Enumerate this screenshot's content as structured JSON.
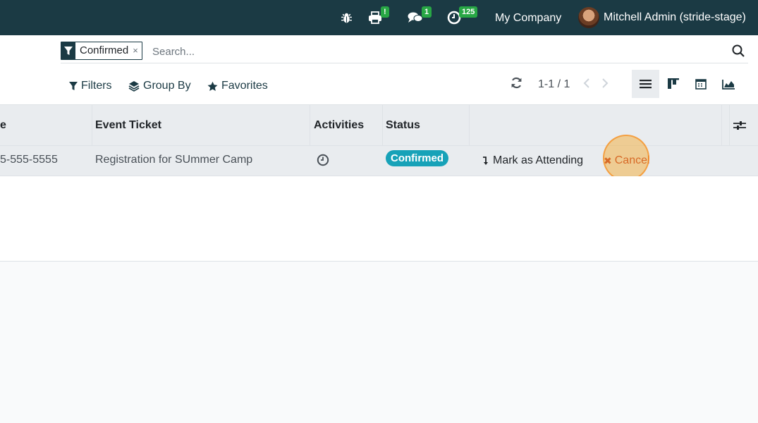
{
  "topbar": {
    "print_badge": "!",
    "chat_badge": "1",
    "activity_badge": "125",
    "company": "My Company",
    "user": "Mitchell Admin (stride-stage)"
  },
  "search": {
    "facet_label": "Confirmed",
    "facet_remove": "×",
    "placeholder": "Search..."
  },
  "filters": {
    "filters_label": "Filters",
    "group_by_label": "Group By",
    "favorites_label": "Favorites"
  },
  "pager": {
    "value": "1-1 / 1"
  },
  "table": {
    "columns": [
      "e",
      "Event Ticket",
      "Activities",
      "Status"
    ],
    "row": {
      "phone": "5-555-5555",
      "ticket": "Registration for SUmmer Camp",
      "status": "Confirmed",
      "attend_label": "Mark as Attending",
      "cancel_label": "Cancel"
    }
  },
  "colors": {
    "navbar": "#1b3a44",
    "badge": "#28a745",
    "status": "#17a2b8",
    "cancel": "#c0392b"
  }
}
